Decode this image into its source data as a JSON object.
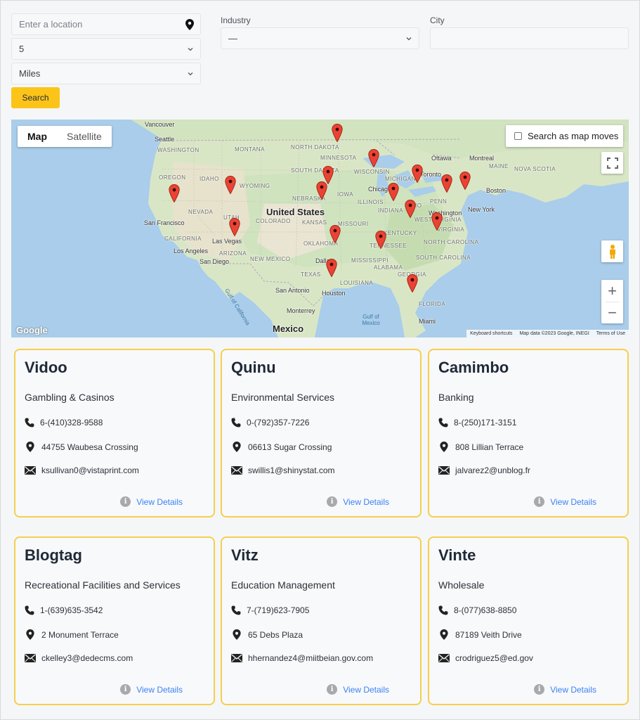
{
  "filters": {
    "location_placeholder": "Enter a location",
    "radius_value": "5",
    "unit_value": "Miles",
    "search_label": "Search",
    "industry_label": "Industry",
    "industry_value": "—",
    "city_label": "City",
    "city_value": ""
  },
  "map": {
    "tab_map": "Map",
    "tab_satellite": "Satellite",
    "search_as_moves": "Search as map moves",
    "zoom_in": "+",
    "zoom_out": "−",
    "google_logo": "Google",
    "attribution": [
      "Keyboard shortcuts",
      "Map data ©2023 Google, INEGI",
      "Terms of Use"
    ],
    "labels": {
      "vancouver": "Vancouver",
      "seattle": "Seattle",
      "washington": "WASHINGTON",
      "oregon": "OREGON",
      "idaho": "IDAHO",
      "montana": "MONTANA",
      "wyoming": "WYOMING",
      "nevada": "NEVADA",
      "utah": "UTAH",
      "colorado": "COLORADO",
      "california": "CALIFORNIA",
      "arizona": "ARIZONA",
      "new_mexico": "NEW MEXICO",
      "north_dakota": "NORTH DAKOTA",
      "south_dakota": "SOUTH DAKOTA",
      "nebraska": "NEBRASKA",
      "kansas": "KANSAS",
      "oklahoma": "OKLAHOMA",
      "texas": "TEXAS",
      "minnesota": "MINNESOTA",
      "iowa": "IOWA",
      "missouri": "MISSOURI",
      "wisconsin": "WISCONSIN",
      "illinois": "ILLINOIS",
      "michigan": "MICHIGAN",
      "indiana": "INDIANA",
      "ohio": "OHIO",
      "kentucky": "KENTUCKY",
      "tennessee": "TENNESSEE",
      "mississippi": "MISSISSIPPI",
      "alabama": "ALABAMA",
      "georgia": "GEORGIA",
      "louisiana": "LOUISIANA",
      "florida": "FLORIDA",
      "south_carolina": "SOUTH CAROLINA",
      "north_carolina": "NORTH CAROLINA",
      "virginia": "VIRGINIA",
      "west_virginia": "WEST VIRGINIA",
      "pennsylvania": "PENN",
      "maine": "MAINE",
      "nova_scotia": "NOVA SCOTIA",
      "us": "United States",
      "mexico": "Mexico",
      "san_francisco": "San Francisco",
      "los_angeles": "Los Angeles",
      "san_diego": "San Diego",
      "las_vegas": "Las Vegas",
      "dallas": "Dallas",
      "houston": "Houston",
      "san_antonio": "San Antonio",
      "monterrey": "Monterrey",
      "chicago": "Chicago",
      "toronto": "Toronto",
      "ottawa": "Ottawa",
      "montreal": "Montreal",
      "boston": "Boston",
      "new_york": "New York",
      "washington_dc": "Washington",
      "miami": "Miami",
      "gulf_of_mexico": "Gulf of Mexico",
      "gulf_of_california": "Gulf of California"
    }
  },
  "cards": [
    {
      "name": "Vidoo",
      "industry": "Gambling & Casinos",
      "phone": "6-(410)328-9588",
      "address": "44755 Waubesa Crossing",
      "email": "ksullivan0@vistaprint.com",
      "details": "View Details"
    },
    {
      "name": "Quinu",
      "industry": "Environmental Services",
      "phone": "0-(792)357-7226",
      "address": "06613 Sugar Crossing",
      "email": "swillis1@shinystat.com",
      "details": "View Details"
    },
    {
      "name": "Camimbo",
      "industry": "Banking",
      "phone": "8-(250)171-3151",
      "address": "808 Lillian Terrace",
      "email": "jalvarez2@unblog.fr",
      "details": "View Details"
    },
    {
      "name": "Blogtag",
      "industry": "Recreational Facilities and Services",
      "phone": "1-(639)635-3542",
      "address": "2 Monument Terrace",
      "email": "ckelley3@dedecms.com",
      "details": "View Details"
    },
    {
      "name": "Vitz",
      "industry": "Education Management",
      "phone": "7-(719)623-7905",
      "address": "65 Debs Plaza",
      "email": "hhernandez4@miitbeian.gov.com",
      "details": "View Details"
    },
    {
      "name": "Vinte",
      "industry": "Wholesale",
      "phone": "8-(077)638-8850",
      "address": "87189 Veith Drive",
      "email": "crodriguez5@ed.gov",
      "details": "View Details"
    }
  ],
  "icons": {
    "info": "i"
  }
}
